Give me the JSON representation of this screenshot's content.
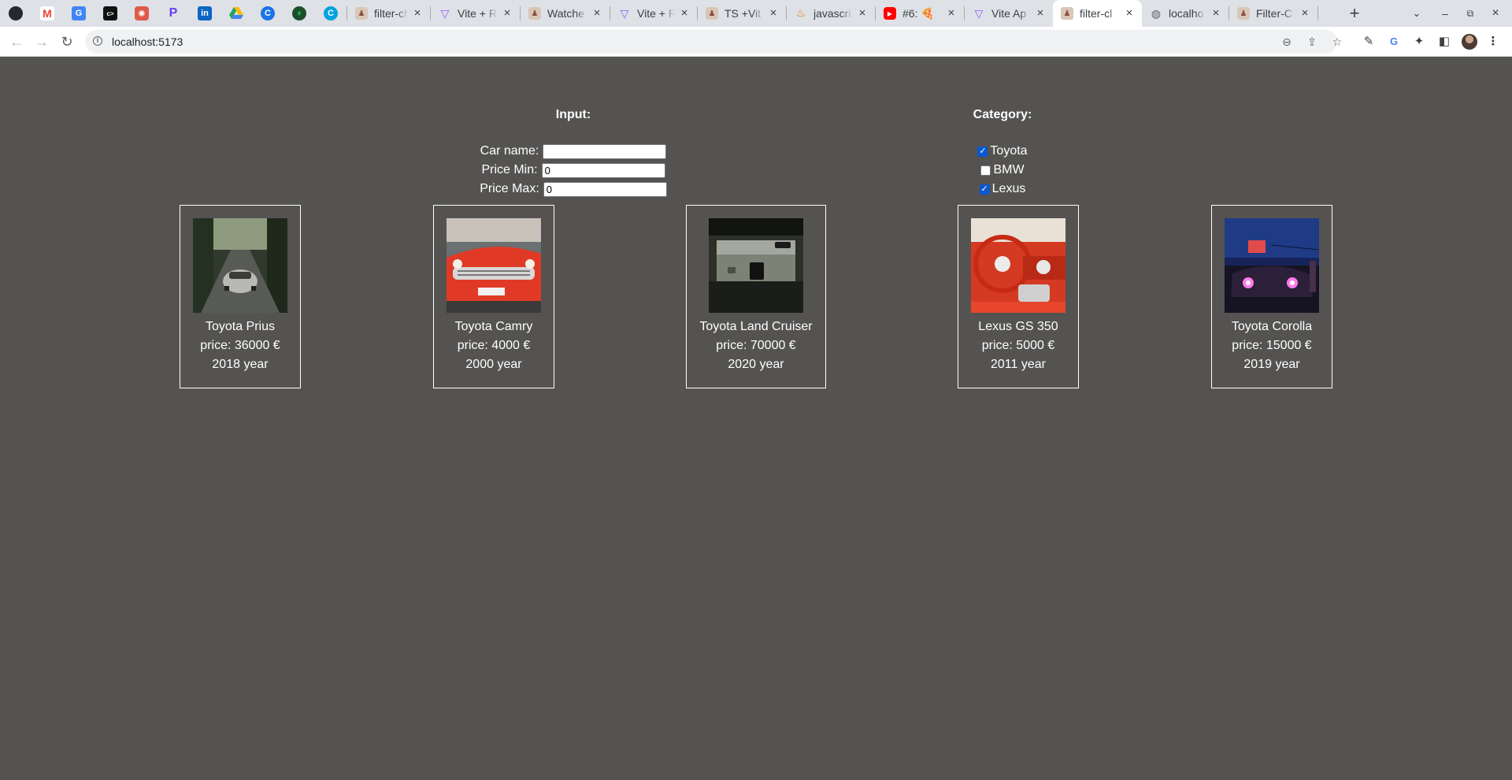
{
  "browser": {
    "pinned_tabs": [
      {
        "icon": "github-icon",
        "color": "#24292f"
      },
      {
        "icon": "gmail-icon",
        "color": "#ea4335"
      },
      {
        "icon": "translate-icon",
        "color": "#4285f4"
      },
      {
        "icon": "terminal-icon",
        "color": "#111111"
      },
      {
        "icon": "pinwheel-icon",
        "color": "#e05a4a"
      },
      {
        "icon": "pen-icon",
        "color": "#6c3bf5"
      },
      {
        "icon": "linkedin-icon",
        "color": "#0a66c2"
      },
      {
        "icon": "drive-icon",
        "color": "#1fa463"
      },
      {
        "icon": "c-circle-icon",
        "color": "#1a73e8"
      },
      {
        "icon": "mongodb-icon",
        "color": "#1e4d2b"
      },
      {
        "icon": "c-icon",
        "color": "#00a3e0"
      }
    ],
    "tabs": [
      {
        "title": "filter-ch",
        "icon": "figure-icon",
        "active": false
      },
      {
        "title": "Vite + R",
        "icon": "vite-icon",
        "active": false
      },
      {
        "title": "Watche",
        "icon": "figure-icon",
        "active": false
      },
      {
        "title": "Vite + R",
        "icon": "vite-icon",
        "active": false
      },
      {
        "title": "TS +Vit",
        "icon": "figure-icon",
        "active": false
      },
      {
        "title": "javascri",
        "icon": "java-icon",
        "active": false
      },
      {
        "title": "#6: 🍕 ",
        "icon": "youtube-icon",
        "active": false
      },
      {
        "title": "Vite Ap",
        "icon": "vite-icon",
        "active": false
      },
      {
        "title": "filter-cl",
        "icon": "figure-icon",
        "active": true
      },
      {
        "title": "localho",
        "icon": "globe-icon",
        "active": false
      },
      {
        "title": "Filter-C",
        "icon": "figure-icon",
        "active": false
      }
    ],
    "url": "localhost:5173"
  },
  "filters": {
    "input": {
      "title": "Input:",
      "car_name_label": "Car name:",
      "car_name_value": "",
      "price_min_label": "Price Min:",
      "price_min_value": "0",
      "price_max_label": "Price Max:",
      "price_max_value": "0"
    },
    "category": {
      "title": "Category:",
      "options": [
        {
          "label": "Toyota",
          "checked": true
        },
        {
          "label": "BMW",
          "checked": false
        },
        {
          "label": "Lexus",
          "checked": true
        }
      ]
    }
  },
  "cars": [
    {
      "name": "Toyota Prius",
      "price": "price: 36000 €",
      "year": "2018 year",
      "photo": "silver-porsche-on-forest-road"
    },
    {
      "name": "Toyota Camry",
      "price": "price: 4000 €",
      "year": "2000 year",
      "photo": "red-classic-car-front"
    },
    {
      "name": "Toyota Land Cruiser",
      "price": "price: 70000 €",
      "year": "2020 year",
      "photo": "car-interior-windshield-view"
    },
    {
      "name": "Lexus GS 350",
      "price": "price: 5000 €",
      "year": "2011 year",
      "photo": "red-car-dashboard-steering-wheel"
    },
    {
      "name": "Toyota Corolla",
      "price": "price: 15000 €",
      "year": "2019 year",
      "photo": "car-headlights-at-night"
    }
  ]
}
